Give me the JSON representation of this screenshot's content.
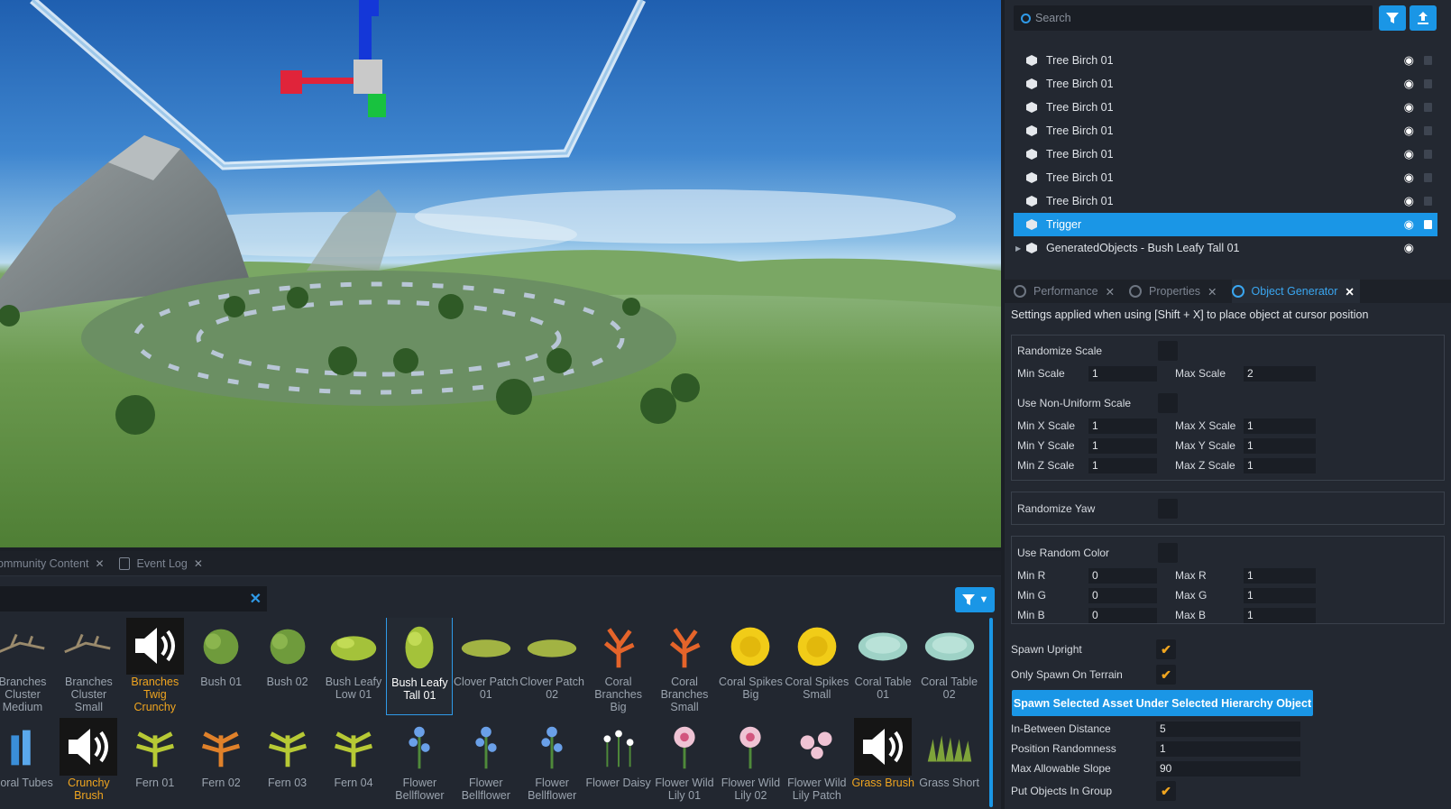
{
  "viewport": {},
  "bottom_panel": {
    "tabs": [
      {
        "label": "Community Content"
      },
      {
        "label": "Event Log"
      }
    ],
    "assets_row1": [
      {
        "label": "Branches Cluster Medium",
        "kind": "branch"
      },
      {
        "label": "Branches Cluster Small",
        "kind": "branch"
      },
      {
        "label": "Branches Twig Crunchy",
        "kind": "audio"
      },
      {
        "label": "Bush 01",
        "kind": "bush"
      },
      {
        "label": "Bush 02",
        "kind": "bush"
      },
      {
        "label": "Bush Leafy Low 01",
        "kind": "leafy"
      },
      {
        "label": "Bush Leafy Tall 01",
        "kind": "leafytall"
      },
      {
        "label": "Clover Patch 01",
        "kind": "clover"
      },
      {
        "label": "Clover Patch 02",
        "kind": "clover"
      },
      {
        "label": "Coral Branches Big",
        "kind": "coral"
      },
      {
        "label": "Coral Branches Small",
        "kind": "coral"
      },
      {
        "label": "Coral Spikes Big",
        "kind": "spikes"
      },
      {
        "label": "Coral Spikes Small",
        "kind": "spikes"
      },
      {
        "label": "Coral Table 01",
        "kind": "table"
      },
      {
        "label": "Coral Table 02",
        "kind": "table"
      }
    ],
    "assets_row2": [
      {
        "label": "Coral Tubes",
        "kind": "tubes"
      },
      {
        "label": "Crunchy Brush",
        "kind": "audio"
      },
      {
        "label": "Fern 01",
        "kind": "fern"
      },
      {
        "label": "Fern 02",
        "kind": "fernorange"
      },
      {
        "label": "Fern 03",
        "kind": "fern"
      },
      {
        "label": "Fern 04",
        "kind": "fern"
      },
      {
        "label": "Flower Bellflower",
        "kind": "bell"
      },
      {
        "label": "Flower Bellflower",
        "kind": "bell"
      },
      {
        "label": "Flower Bellflower",
        "kind": "bell"
      },
      {
        "label": "Flower Daisy",
        "kind": "daisy"
      },
      {
        "label": "Flower Wild Lily 01",
        "kind": "lily"
      },
      {
        "label": "Flower Wild Lily 02",
        "kind": "lily"
      },
      {
        "label": "Flower Wild Lily Patch",
        "kind": "lilypatch"
      },
      {
        "label": "Grass Brush",
        "kind": "audio"
      },
      {
        "label": "Grass Short",
        "kind": "grass"
      }
    ]
  },
  "hierarchy": {
    "search_placeholder": "Search",
    "rows": [
      {
        "label": "Tree Birch 01",
        "icon": "cube-icon"
      },
      {
        "label": "Tree Birch 01",
        "icon": "cube-icon"
      },
      {
        "label": "Tree Birch 01",
        "icon": "cube-icon"
      },
      {
        "label": "Tree Birch 01",
        "icon": "cube-icon"
      },
      {
        "label": "Tree Birch 01",
        "icon": "cube-icon"
      },
      {
        "label": "Tree Birch 01",
        "icon": "cube-icon"
      },
      {
        "label": "Tree Birch 01",
        "icon": "cube-icon"
      },
      {
        "label": "Trigger",
        "icon": "trigger-icon",
        "selected": true
      },
      {
        "label": "GeneratedObjects - Bush Leafy Tall 01",
        "icon": "folder-icon"
      }
    ]
  },
  "right_tabs": [
    {
      "label": "Performance"
    },
    {
      "label": "Properties"
    },
    {
      "label": "Object Generator",
      "active": true
    }
  ],
  "generator": {
    "note": "Settings applied when using [Shift + X] to place object at cursor position",
    "randomize_scale": "Randomize Scale",
    "min_scale_label": "Min Scale",
    "min_scale": "1",
    "max_scale_label": "Max Scale",
    "max_scale": "2",
    "non_uniform": "Use Non-Uniform Scale",
    "min_x_label": "Min X Scale",
    "min_x": "1",
    "max_x_label": "Max X Scale",
    "max_x": "1",
    "min_y_label": "Min Y Scale",
    "min_y": "1",
    "max_y_label": "Max Y Scale",
    "max_y": "1",
    "min_z_label": "Min Z Scale",
    "min_z": "1",
    "max_z_label": "Max Z Scale",
    "max_z": "1",
    "randomize_yaw": "Randomize Yaw",
    "random_color": "Use Random Color",
    "min_r_label": "Min R",
    "min_r": "0",
    "max_r_label": "Max R",
    "max_r": "1",
    "min_g_label": "Min G",
    "min_g": "0",
    "max_g_label": "Max G",
    "max_g": "1",
    "min_b_label": "Min B",
    "min_b": "0",
    "max_b_label": "Max B",
    "max_b": "1",
    "spawn_upright": "Spawn Upright",
    "only_terrain": "Only Spawn On Terrain",
    "spawn_button": "Spawn Selected Asset Under Selected Hierarchy Object",
    "between_label": "In-Between Distance",
    "between": "5",
    "randomness_label": "Position Randomness",
    "randomness": "1",
    "slope_label": "Max Allowable Slope",
    "slope": "90",
    "group_label": "Put Objects In Group",
    "checkmark": "✔"
  }
}
